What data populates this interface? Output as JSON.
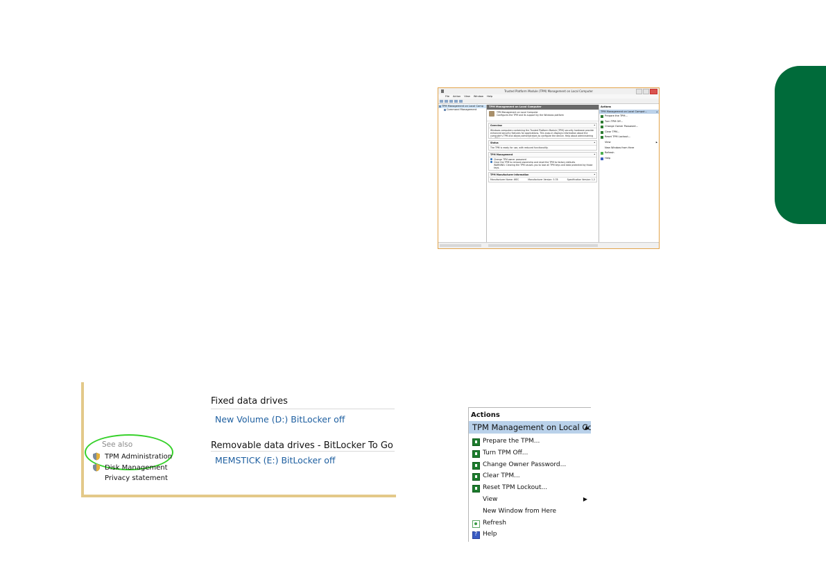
{
  "mmc_window": {
    "title": "Trusted Platform Module (TPM) Management on Local Computer",
    "menu": [
      "File",
      "Action",
      "View",
      "Window",
      "Help"
    ],
    "tree": [
      "TPM Management on Local Comp",
      "Command Management"
    ],
    "center": {
      "header": "TPM Management on Local Computer",
      "intro_line1": "TPM Management on Local Computer",
      "intro_line2": "Configures the TPM and its support by the Windows platform",
      "overview_title": "Overview",
      "overview_text": "Windows computers containing the Trusted Platform Module (TPM) security hardware provide enhanced security features for applications. This snap-in displays information about the computer's TPM and allows administrators to configure the device. Help about administering the TPM on your computer is provided by the above.",
      "status_title": "Status",
      "status_text": "The TPM is ready for use, with reduced functionality.",
      "mgmt_title": "TPM Management",
      "mgmt_item1": "Change TPM owner password",
      "mgmt_item2": "Clear the TPM to remove ownership and reset the TPM to factory defaults",
      "mgmt_warning": "WARNING: Clearing the TPM causes you to lose all TPM keys and data protected by those keys.",
      "mfr_title": "TPM Manufacturer Information",
      "mfr_name": "Manufacturer Name: WEC",
      "mfr_version": "Manufacturer Version: 5.78",
      "spec_version": "Specification Version: 1.2"
    },
    "actions": {
      "header": "Actions",
      "subheader": "TPM Management on Local Comput...",
      "items": [
        "Prepare the TPM...",
        "Turn TPM Off...",
        "Change Owner Password...",
        "Clear TPM...",
        "Reset TPM Lockout...",
        "View",
        "New Window from Here",
        "Refresh",
        "Help"
      ]
    }
  },
  "bitlocker_panel": {
    "see_also": "See also",
    "links": [
      "TPM Administration",
      "Disk Management",
      "Privacy statement"
    ],
    "fixed_heading": "Fixed data drives",
    "fixed_drive": "New Volume (D:) BitLocker off",
    "removable_heading": "Removable data drives - BitLocker To Go",
    "removable_drive": "MEMSTICK (E:) BitLocker off"
  },
  "actions_panel": {
    "header": "Actions",
    "subheader": "TPM Management on Local Comput...",
    "items": [
      "Prepare the TPM...",
      "Turn TPM Off...",
      "Change Owner Password...",
      "Clear TPM...",
      "Reset TPM Lockout...",
      "View",
      "New Window from Here",
      "Refresh",
      "Help"
    ]
  },
  "colors": {
    "side_tab": "#006b3a",
    "panel_border": "#e3c989",
    "highlight_ring": "#36d12a",
    "link_blue": "#1e5fa0",
    "actions_subheader_bg": "#b9d1ea"
  }
}
